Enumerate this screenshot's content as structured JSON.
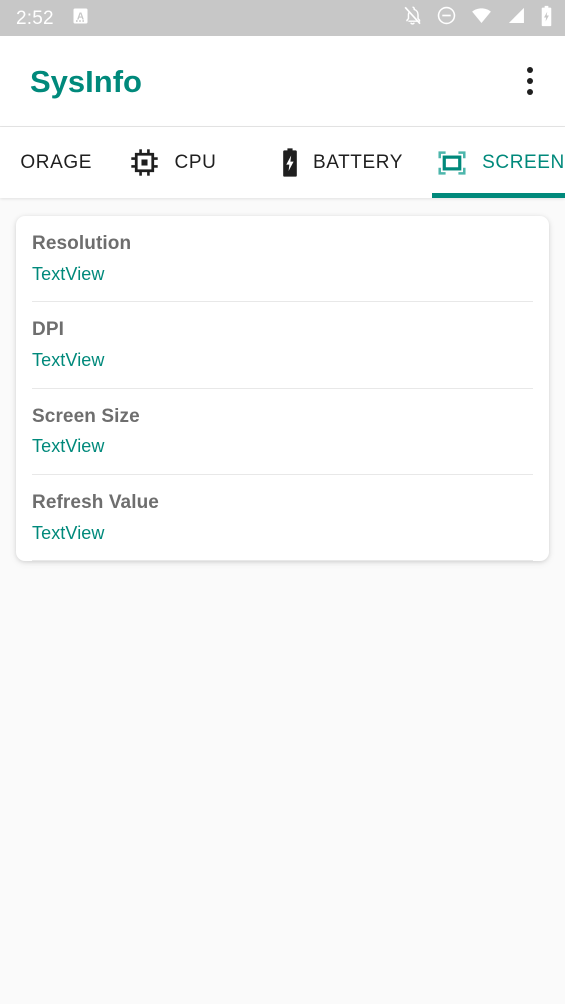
{
  "status_bar": {
    "time": "2:52",
    "left_icons": [
      "app-badge-a-icon"
    ],
    "right_icons": [
      "notifications-off-icon",
      "do-not-disturb-icon",
      "wifi-icon",
      "cellular-signal-icon",
      "battery-charging-icon"
    ],
    "background_color": "#c7c7c7"
  },
  "app_bar": {
    "title": "SysInfo",
    "title_color": "#00897b",
    "overflow_menu_label": "More options",
    "overflow_icon": "more-vert-icon"
  },
  "tabs": {
    "accent_color": "#00897b",
    "items": [
      {
        "label": "ORAGE",
        "full_label": "STORAGE",
        "icon": "storage-icon",
        "active": false,
        "clipped": true
      },
      {
        "label": "CPU",
        "icon": "cpu-chip-icon",
        "active": false,
        "clipped": false
      },
      {
        "label": "BATTERY",
        "icon": "battery-charging-icon",
        "active": false,
        "clipped": false
      },
      {
        "label": "SCREEN",
        "icon": "screen-crop-icon",
        "active": true,
        "clipped": false
      }
    ]
  },
  "screen_info": {
    "rows": [
      {
        "label": "Resolution",
        "value": "TextView"
      },
      {
        "label": "DPI",
        "value": "TextView"
      },
      {
        "label": "Screen Size",
        "value": "TextView"
      },
      {
        "label": "Refresh Value",
        "value": "TextView"
      }
    ]
  },
  "colors": {
    "accent": "#00897b",
    "label_text": "#6e6e6e",
    "page_background": "#fafafa",
    "card_background": "#ffffff",
    "divider": "#e8e8e8"
  }
}
